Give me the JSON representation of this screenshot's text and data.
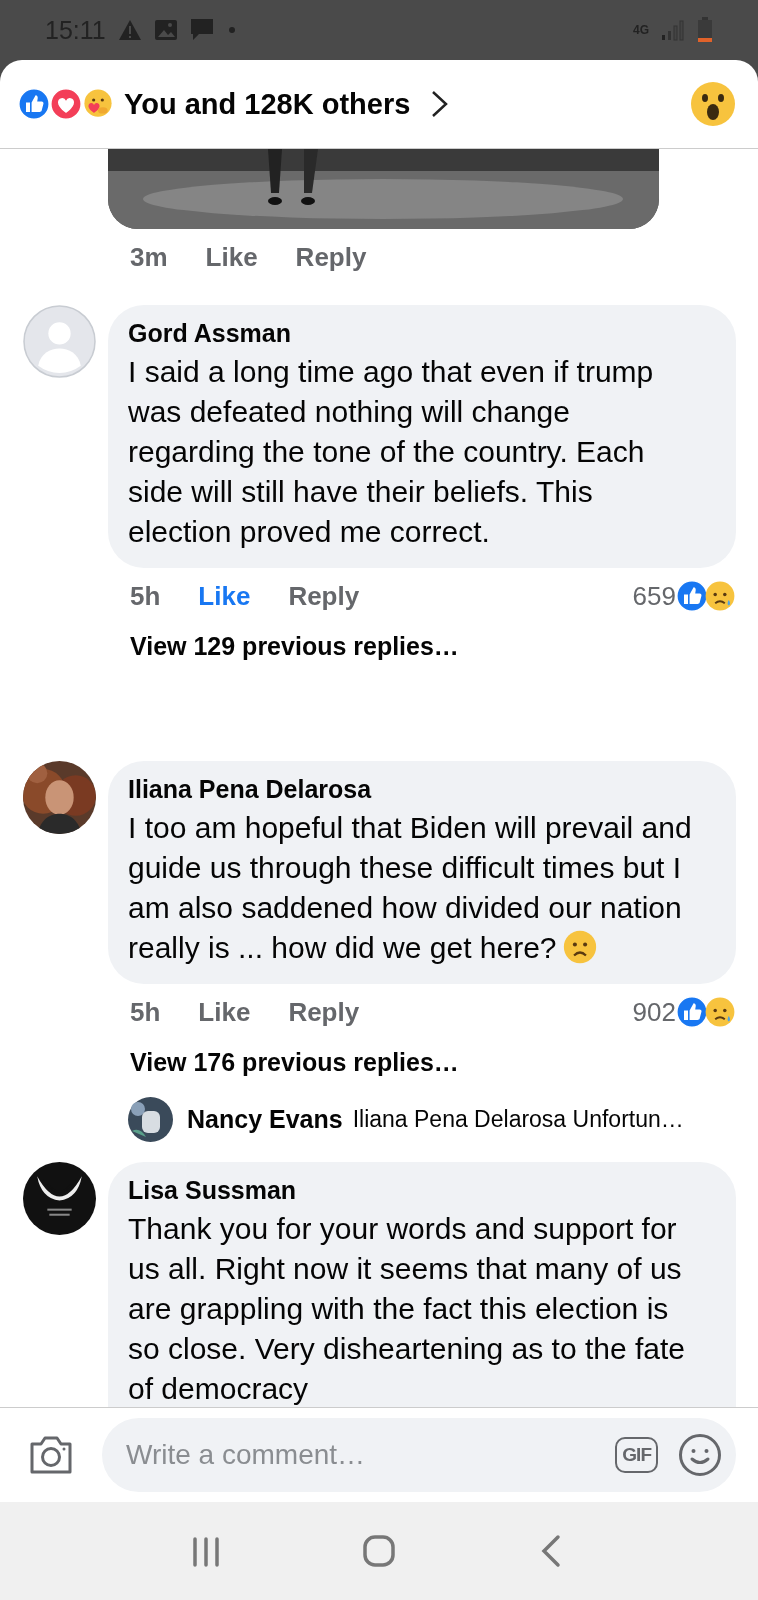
{
  "status_bar": {
    "time": "15:11",
    "network": "4G"
  },
  "reactions_header": {
    "label": "You and 128K others"
  },
  "top_comment": {
    "time": "3m",
    "like_label": "Like",
    "liked": false,
    "reply_label": "Reply"
  },
  "comments": [
    {
      "author": "Gord Assman",
      "kind": "silhouette",
      "text": "I said a long time ago that even if trump was defeated nothing will change regarding the tone of the country. Each side will still have their beliefs. This election proved me correct.",
      "emoji": false,
      "time": "5h",
      "like_label": "Like",
      "liked": true,
      "reply_label": "Reply",
      "reaction_count": "659",
      "view_replies": "View 129 previous replies…"
    },
    {
      "author": "Iliana Pena Delarosa",
      "text": "I too am hopeful that Biden will prevail and guide us through these difficult times but I am also saddened how divided our nation really is ... how did we get here?",
      "emoji": true,
      "time": "5h",
      "like_label": "Like",
      "liked": false,
      "reply_label": "Reply",
      "reaction_count": "902",
      "view_replies": "View 176 previous replies…",
      "latest_reply": {
        "author": "Nancy Evans",
        "text": "Iliana Pena Delarosa Unfortun…"
      }
    },
    {
      "author": "Lisa Sussman",
      "kind": "emblem",
      "text": "Thank you for your words and support for us all. Right now it seems that many of us are grappling with the fact this election is so close. Very disheartening as to the fate of democracy",
      "emoji": false
    }
  ],
  "composer": {
    "placeholder": "Write a comment…",
    "gif_label": "GIF"
  }
}
